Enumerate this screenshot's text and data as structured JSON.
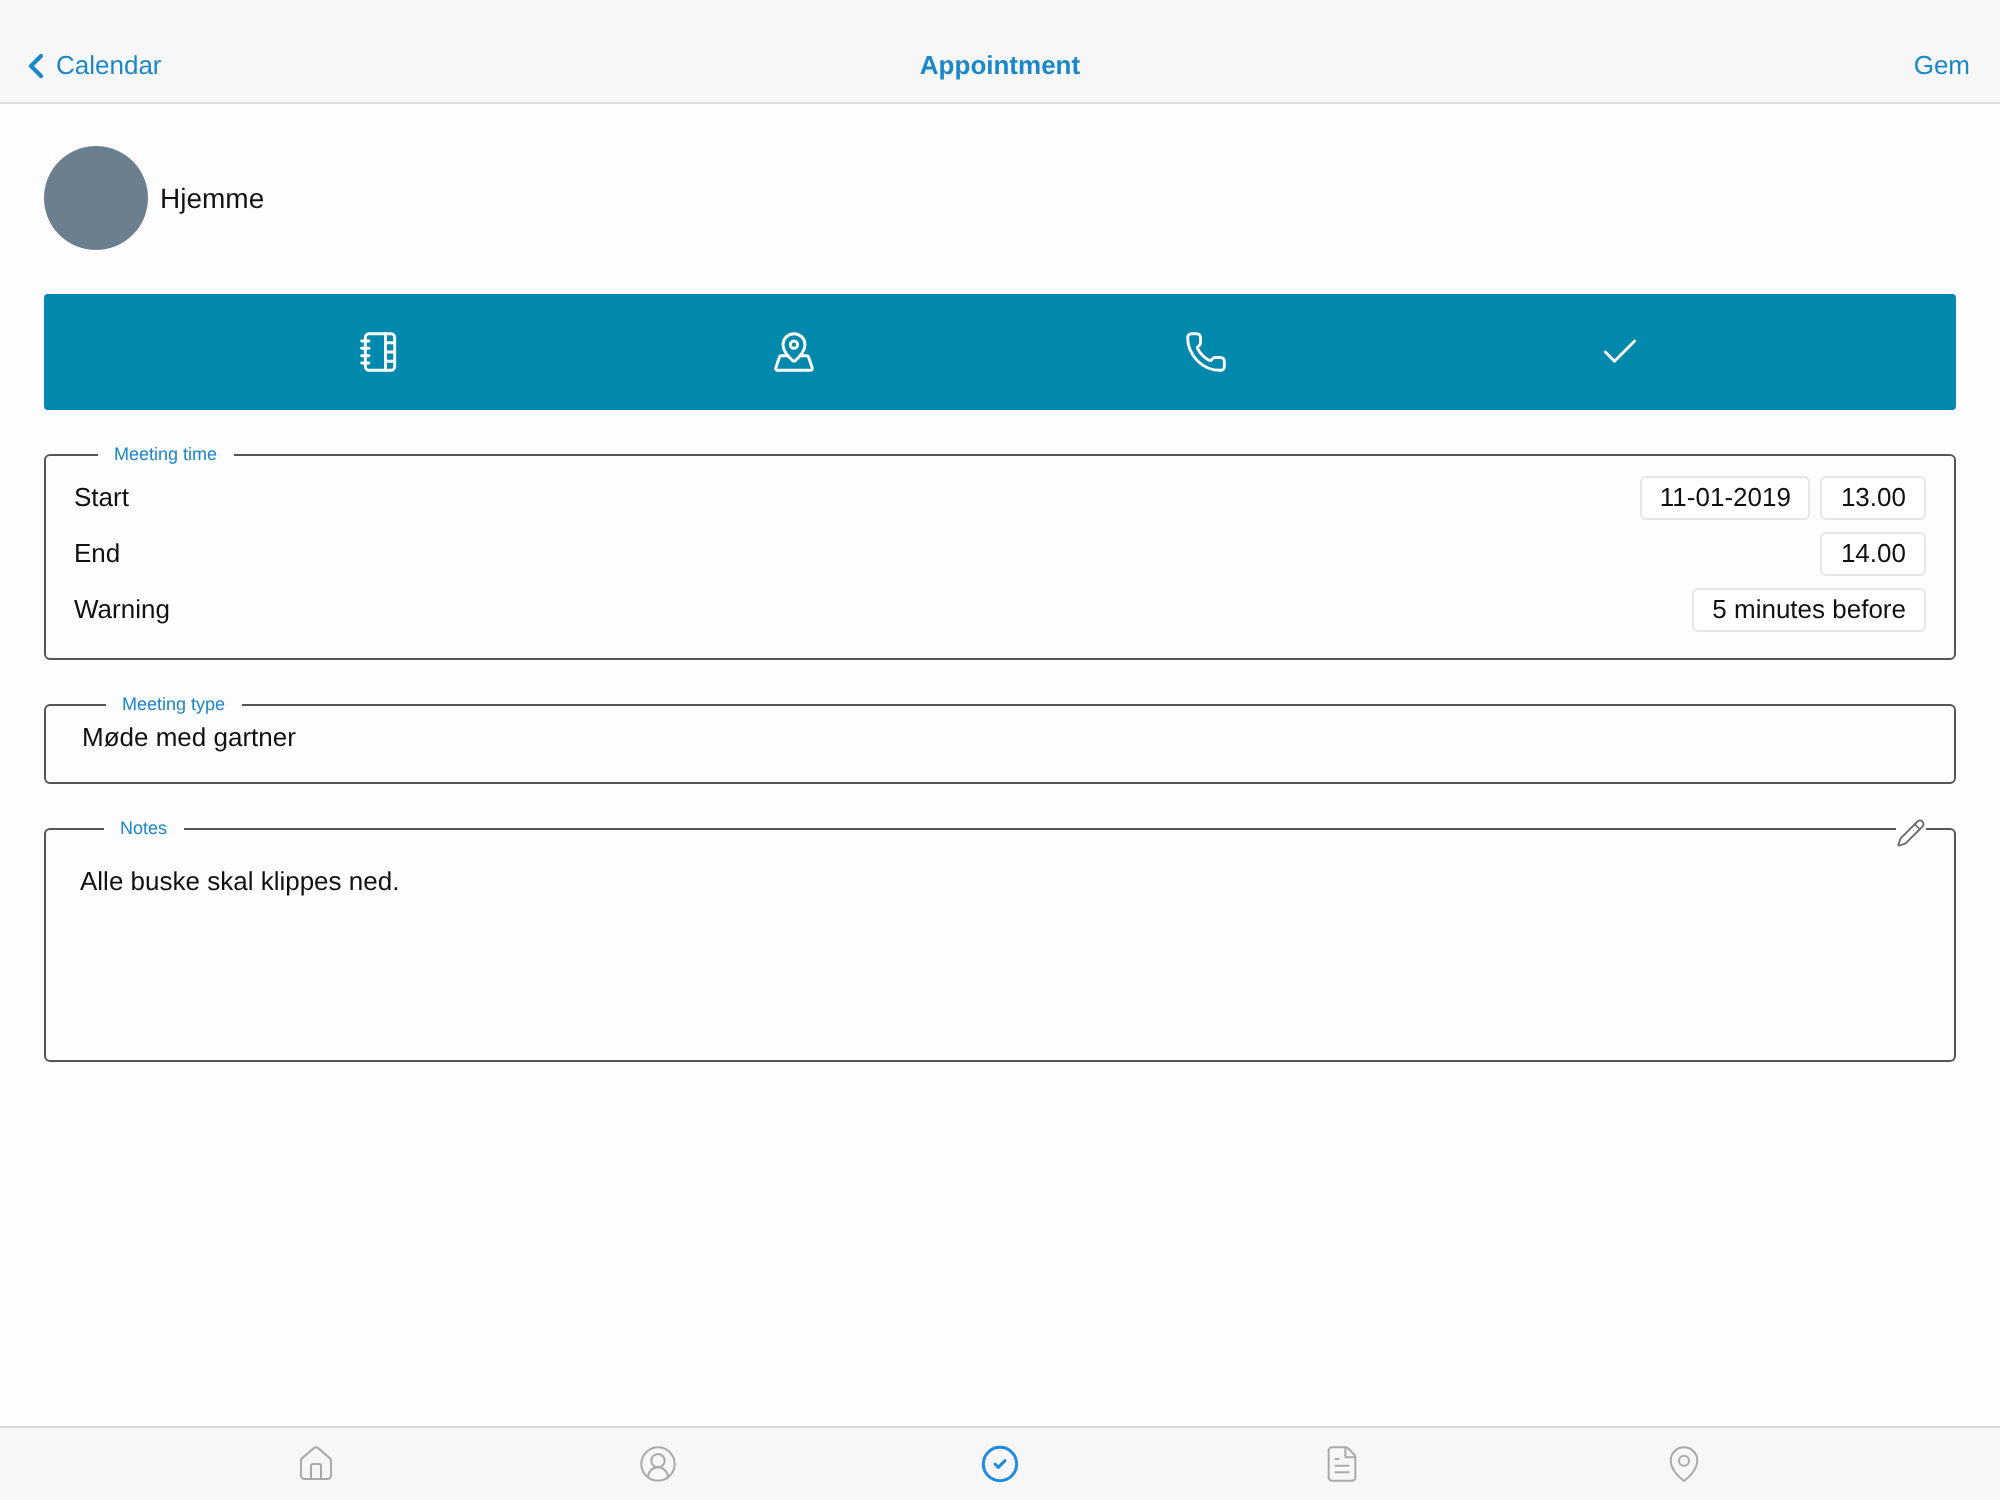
{
  "nav": {
    "back": "Calendar",
    "title": "Appointment",
    "action": "Gem"
  },
  "location": {
    "name": "Hjemme"
  },
  "meeting_time": {
    "legend": "Meeting time",
    "rows": [
      {
        "label": "Start",
        "values": [
          "11-01-2019",
          "13.00"
        ]
      },
      {
        "label": "End",
        "values": [
          "14.00"
        ]
      },
      {
        "label": "Warning",
        "values": [
          "5 minutes before"
        ]
      }
    ]
  },
  "meeting_type": {
    "legend": "Meeting type",
    "value": "Møde med gartner"
  },
  "notes": {
    "legend": "Notes",
    "value": "Alle buske skal klippes ned."
  },
  "tab_bar": [
    {
      "selected": false
    },
    {
      "selected": false
    },
    {
      "selected": true
    },
    {
      "selected": false
    },
    {
      "selected": false
    }
  ]
}
